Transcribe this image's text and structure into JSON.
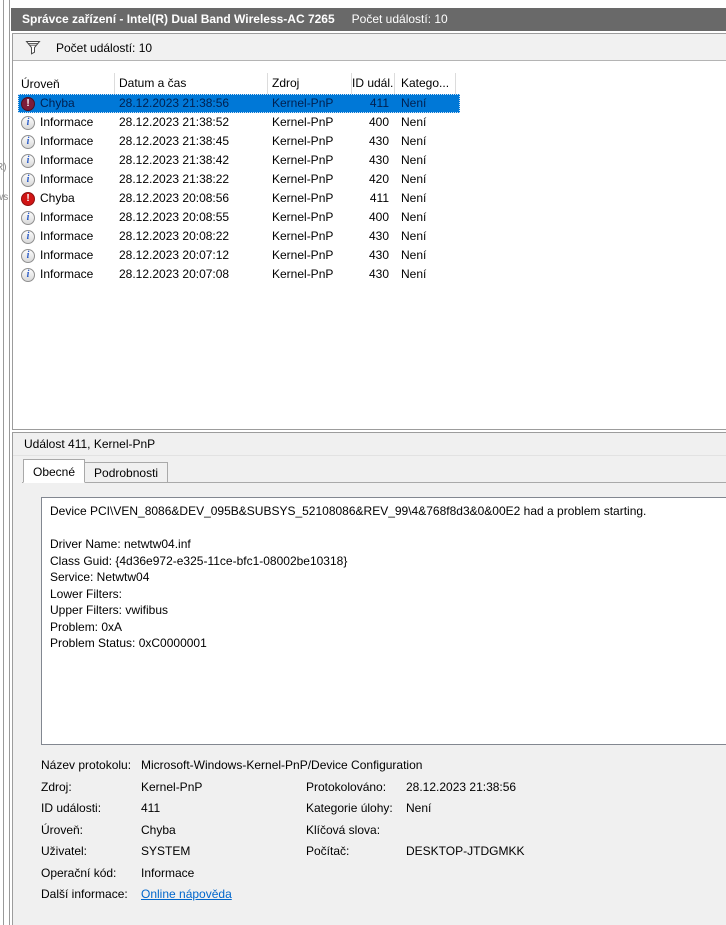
{
  "window": {
    "title": "Správce zařízení - Intel(R) Dual Band Wireless-AC 7265",
    "title_suffix": "Počet událostí: 10"
  },
  "toolbar": {
    "filter_icon": "funnel-icon",
    "label": "Počet událostí: 10"
  },
  "event_list": {
    "columns": [
      "Úroveň",
      "Datum a čas",
      "Zdroj",
      "ID udál...",
      "Katego..."
    ],
    "rows": [
      {
        "level": "Chyba",
        "icon": "error",
        "datetime": "28.12.2023 21:38:56",
        "source": "Kernel-PnP",
        "id": "411",
        "category": "Není",
        "selected": true
      },
      {
        "level": "Informace",
        "icon": "info",
        "datetime": "28.12.2023 21:38:52",
        "source": "Kernel-PnP",
        "id": "400",
        "category": "Není",
        "selected": false
      },
      {
        "level": "Informace",
        "icon": "info",
        "datetime": "28.12.2023 21:38:45",
        "source": "Kernel-PnP",
        "id": "430",
        "category": "Není",
        "selected": false
      },
      {
        "level": "Informace",
        "icon": "info",
        "datetime": "28.12.2023 21:38:42",
        "source": "Kernel-PnP",
        "id": "430",
        "category": "Není",
        "selected": false
      },
      {
        "level": "Informace",
        "icon": "info",
        "datetime": "28.12.2023 21:38:22",
        "source": "Kernel-PnP",
        "id": "420",
        "category": "Není",
        "selected": false
      },
      {
        "level": "Chyba",
        "icon": "error",
        "datetime": "28.12.2023 20:08:56",
        "source": "Kernel-PnP",
        "id": "411",
        "category": "Není",
        "selected": false
      },
      {
        "level": "Informace",
        "icon": "info",
        "datetime": "28.12.2023 20:08:55",
        "source": "Kernel-PnP",
        "id": "400",
        "category": "Není",
        "selected": false
      },
      {
        "level": "Informace",
        "icon": "info",
        "datetime": "28.12.2023 20:08:22",
        "source": "Kernel-PnP",
        "id": "430",
        "category": "Není",
        "selected": false
      },
      {
        "level": "Informace",
        "icon": "info",
        "datetime": "28.12.2023 20:07:12",
        "source": "Kernel-PnP",
        "id": "430",
        "category": "Není",
        "selected": false
      },
      {
        "level": "Informace",
        "icon": "info",
        "datetime": "28.12.2023 20:07:08",
        "source": "Kernel-PnP",
        "id": "430",
        "category": "Není",
        "selected": false
      }
    ]
  },
  "detail_panel": {
    "title": "Událost 411, Kernel-PnP",
    "tabs": [
      {
        "label": "Obecné",
        "active": true
      },
      {
        "label": "Podrobnosti",
        "active": false
      }
    ],
    "description_lines": [
      "Device PCI\\VEN_8086&DEV_095B&SUBSYS_52108086&REV_99\\4&768f8d3&0&00E2 had a problem starting.",
      "",
      "Driver Name: netwtw04.inf",
      "Class Guid: {4d36e972-e325-11ce-bfc1-08002be10318}",
      "Service: Netwtw04",
      "Lower Filters:",
      "Upper Filters: vwifibus",
      "Problem: 0xA",
      "Problem Status: 0xC0000001"
    ],
    "field_rows": [
      {
        "left": {
          "label": "Název protokolu:",
          "value": "Microsoft-Windows-Kernel-PnP/Device Configuration"
        },
        "right": null,
        "wide": true
      },
      {
        "left": {
          "label": "Zdroj:",
          "value": "Kernel-PnP"
        },
        "right": {
          "label": "Protokolováno:",
          "value": "28.12.2023 21:38:56"
        }
      },
      {
        "left": {
          "label": "ID události:",
          "value": "411"
        },
        "right": {
          "label": "Kategorie úlohy:",
          "value": "Není"
        }
      },
      {
        "left": {
          "label": "Úroveň:",
          "value": "Chyba"
        },
        "right": {
          "label": "Klíčová slova:",
          "value": ""
        }
      },
      {
        "left": {
          "label": "Uživatel:",
          "value": "SYSTEM"
        },
        "right": {
          "label": "Počítač:",
          "value": "DESKTOP-JTDGMKK"
        }
      },
      {
        "left": {
          "label": "Operační kód:",
          "value": "Informace"
        },
        "right": null
      },
      {
        "left": {
          "label": "Další informace:",
          "value": "Online nápověda",
          "link": true
        },
        "right": null
      }
    ]
  },
  "background_fragments": [
    "R)",
    "ws"
  ],
  "colors": {
    "titlebar": "#696969",
    "selection": "#0078d7",
    "error_icon": "#d11515",
    "info_icon": "#2a5bc7",
    "link": "#0066cc",
    "panel_gray": "#f0f0f0"
  }
}
